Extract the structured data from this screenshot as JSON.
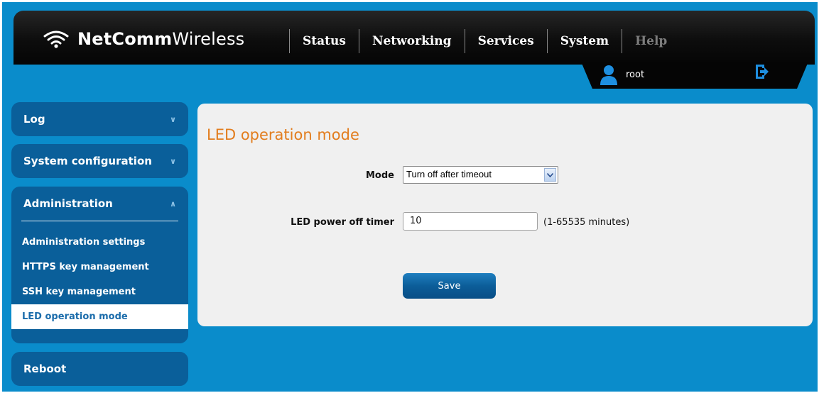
{
  "header": {
    "brand_bold": "NetComm",
    "brand_light": "Wireless",
    "nav": [
      "Status",
      "Networking",
      "Services",
      "System",
      "Help"
    ],
    "user": "root"
  },
  "icons": {
    "logo": "wifi-signal-icon",
    "user": "user-icon",
    "logout": "logout-icon",
    "select_arrow": "chevron-down-icon"
  },
  "sidebar": {
    "log": "Log",
    "system_configuration": "System configuration",
    "administration": "Administration",
    "admin_items": [
      "Administration settings",
      "HTTPS key management",
      "SSH key management",
      "LED operation mode"
    ],
    "reboot": "Reboot"
  },
  "main": {
    "title": "LED operation mode",
    "mode_label": "Mode",
    "mode_value": "Turn off after timeout",
    "timer_label": "LED power off timer",
    "timer_value": "10",
    "timer_hint": "(1-65535 minutes)",
    "save": "Save"
  },
  "colors": {
    "background": "#0a8ccb",
    "sidebar": "#0a5f9a",
    "title": "#e27d1e",
    "active_item_text": "#1b6cab"
  }
}
